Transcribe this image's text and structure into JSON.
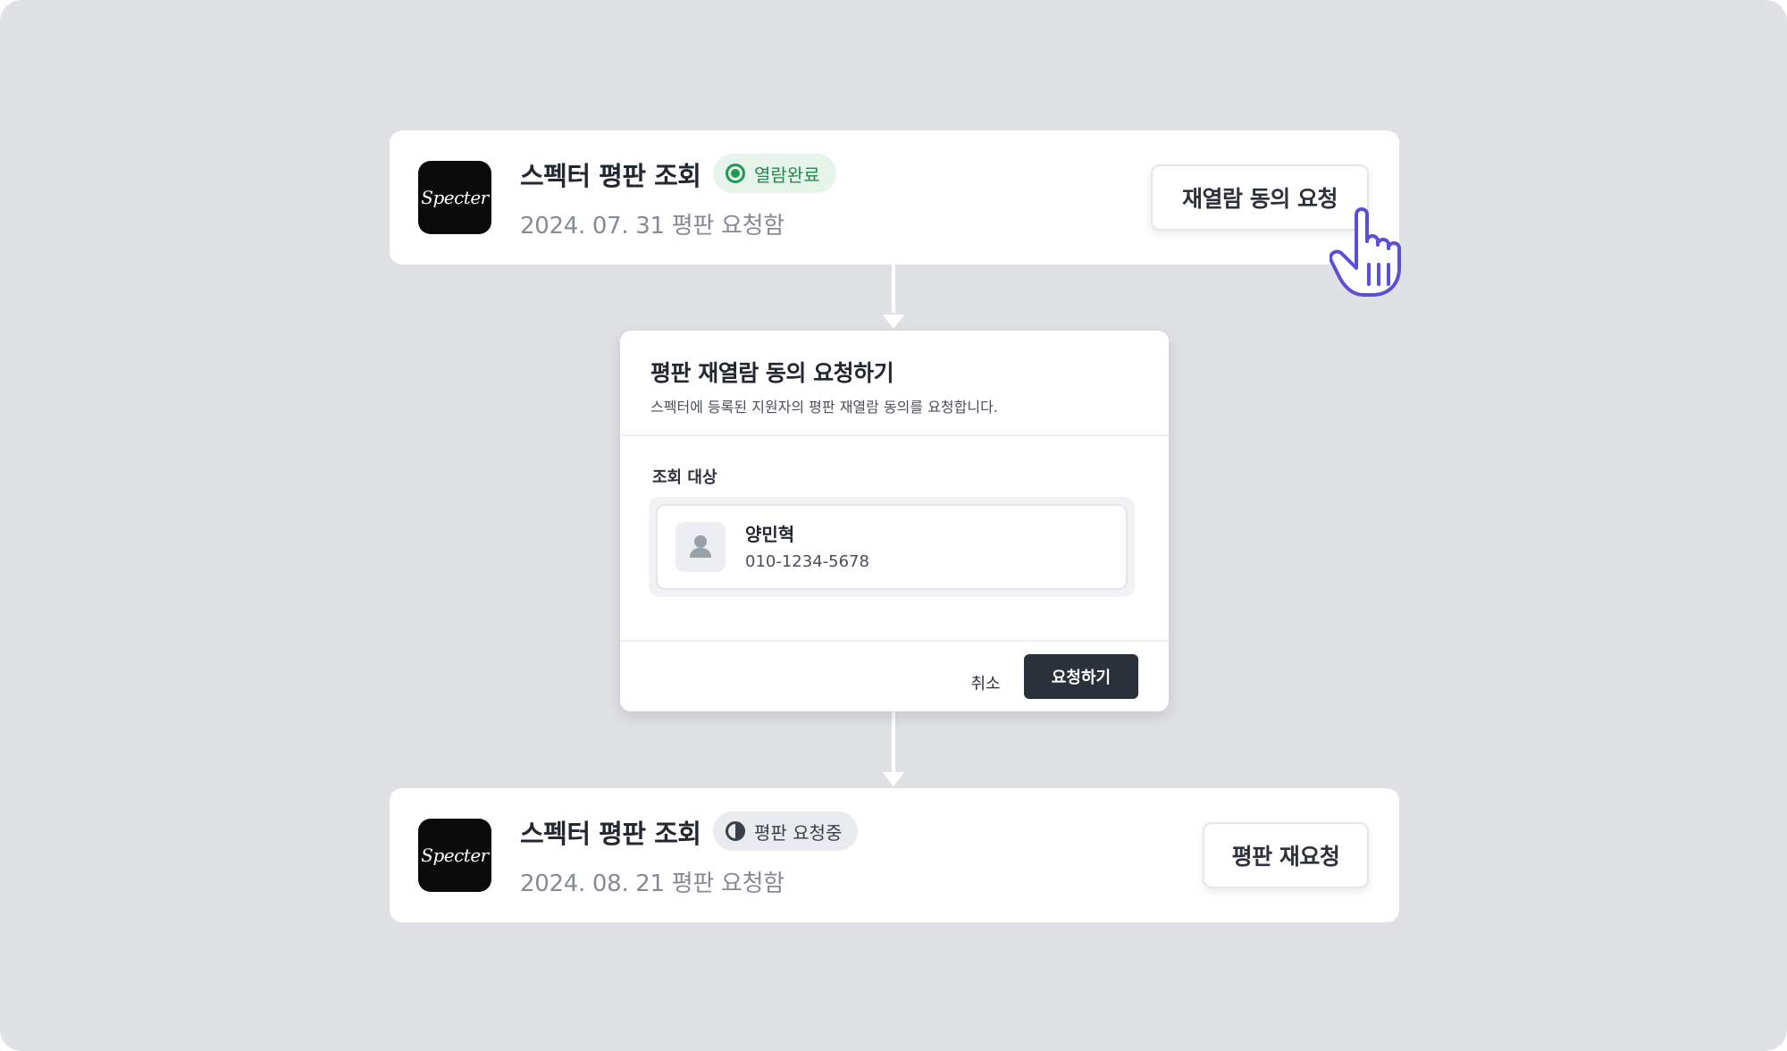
{
  "colors": {
    "background": "#dfe1e5",
    "card": "#ffffff",
    "primary_button": "#2b313a",
    "success": "#1f9a54",
    "cursor_accent": "#5b4fd6"
  },
  "first_card": {
    "logo_text": "Specter",
    "title": "스펙터 평판 조회",
    "badge": {
      "icon": "radio-filled-icon",
      "label": "열람완료"
    },
    "subtitle": "2024. 07. 31 평판 요청함",
    "button_label": "재열람 동의 요청"
  },
  "modal": {
    "title": "평판 재열람 동의 요청하기",
    "description": "스펙터에 등록된 지원자의 평판 재열람 동의를 요청합니다.",
    "section_label": "조회 대상",
    "target": {
      "icon": "user-avatar-icon",
      "name": "양민혁",
      "phone": "010-1234-5678"
    },
    "cancel_label": "취소",
    "confirm_label": "요청하기"
  },
  "second_card": {
    "logo_text": "Specter",
    "title": "스펙터 평판 조회",
    "badge": {
      "icon": "half-circle-icon",
      "label": "평판 요청중"
    },
    "subtitle": "2024. 08. 21 평판 요청함",
    "button_label": "평판 재요청"
  },
  "cursor_icon": "pointer-hand-icon"
}
